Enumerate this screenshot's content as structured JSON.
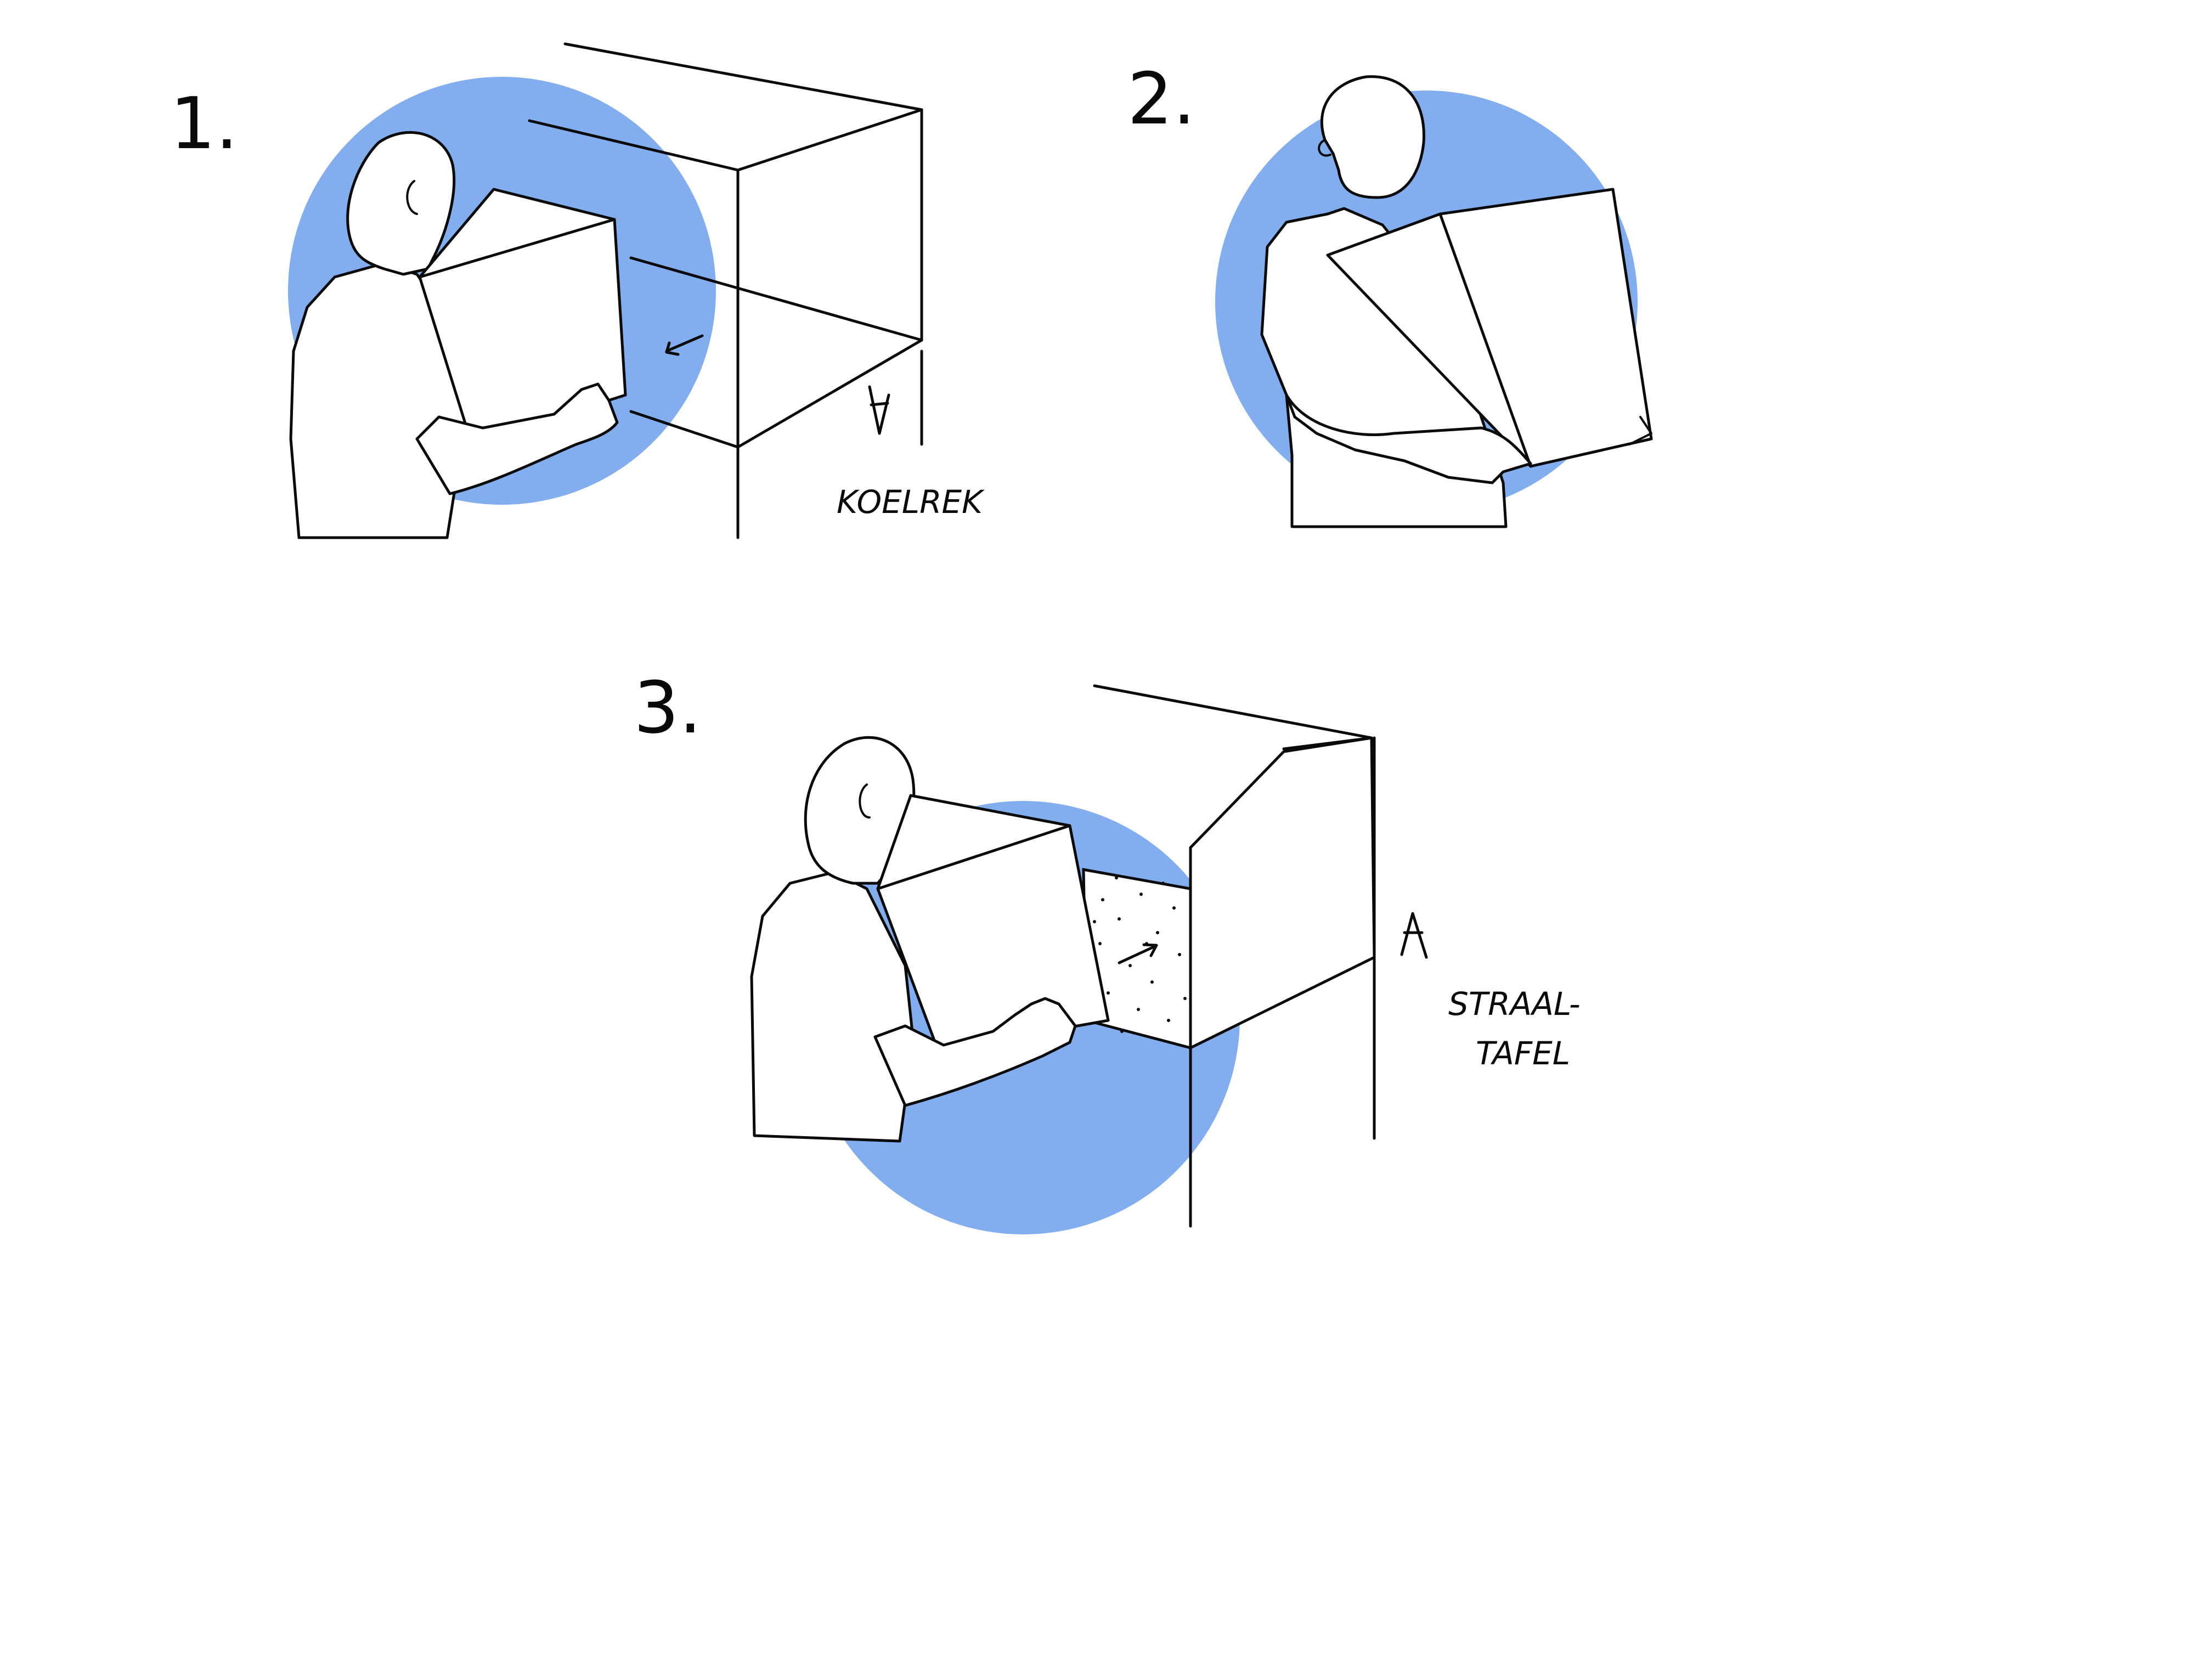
{
  "colors": {
    "accent_circle": "#82ADEF",
    "ink": "#0a0a0a",
    "background": "#ffffff"
  },
  "steps": [
    {
      "number": "1.",
      "label": "KOELREK"
    },
    {
      "number": "2.",
      "label": ""
    },
    {
      "number": "3.",
      "label_line1": "STRAAL-",
      "label_line2": "TAFEL"
    }
  ]
}
